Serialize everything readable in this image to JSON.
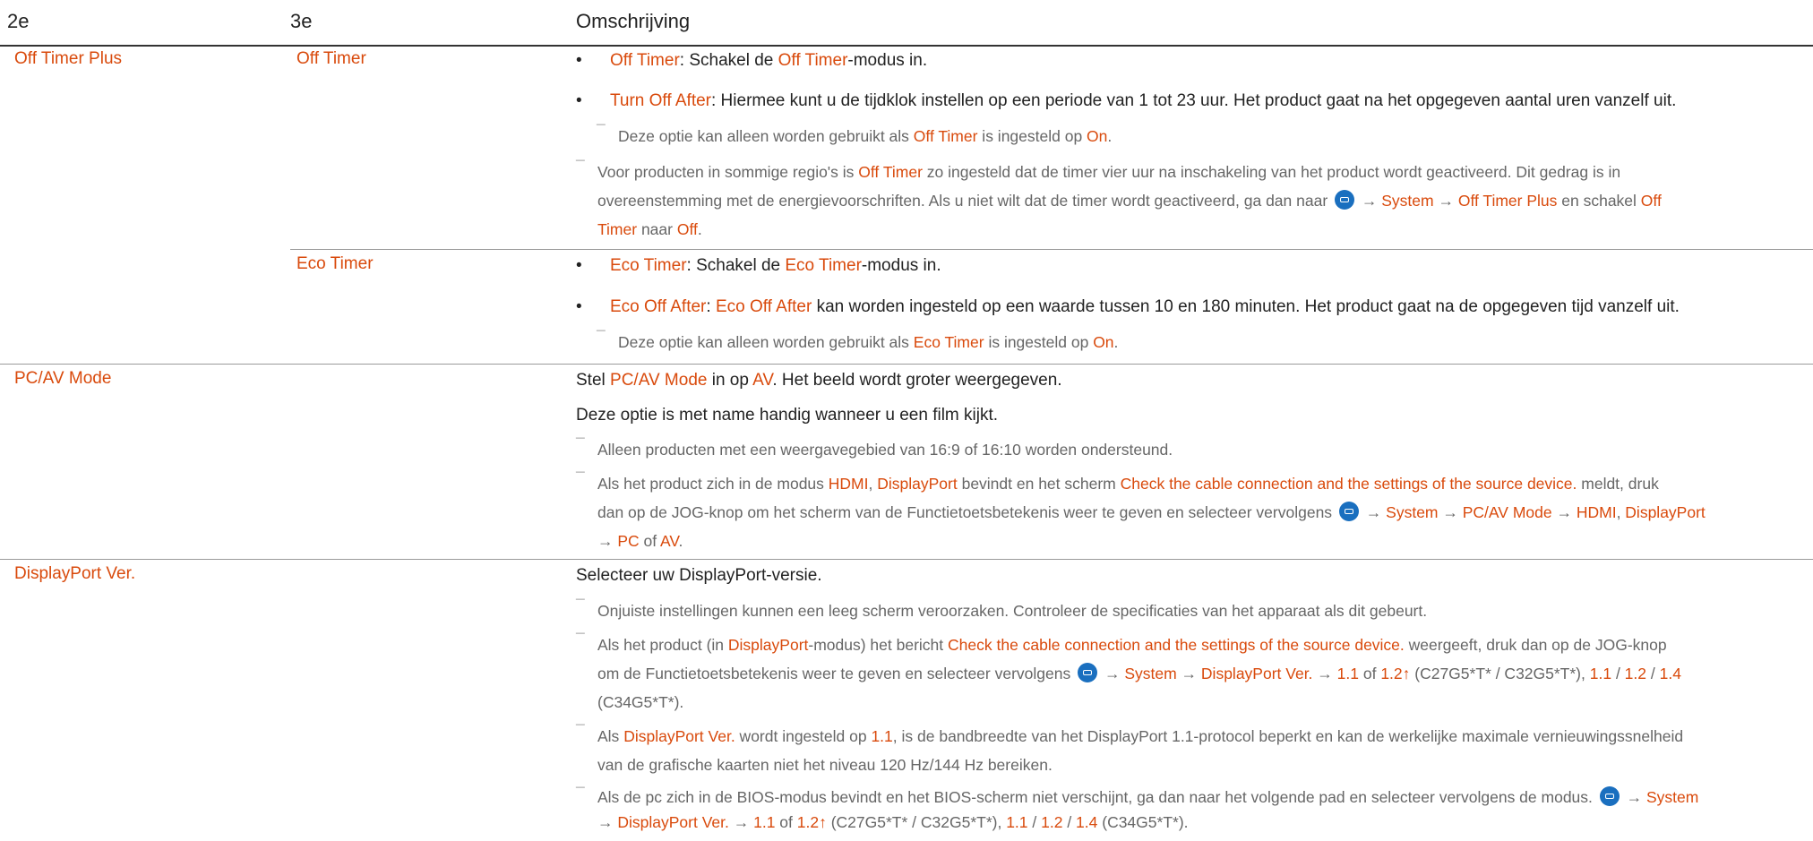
{
  "header": {
    "col1": "2e",
    "col2": "3e",
    "col3": "Omschrijving"
  },
  "sections": {
    "off_timer_plus": {
      "label": "Off Timer Plus",
      "off_timer": {
        "label": "Off Timer",
        "b1": {
          "t1": "Off Timer",
          "t2": ": Schakel de ",
          "t3": "Off Timer",
          "t4": "-modus in."
        },
        "b2": {
          "t1": "Turn Off After",
          "t2": ": Hiermee kunt u de tijdklok instellen op een periode van 1 tot 23 uur. Het product gaat na het opgegeven aantal uren vanzelf uit."
        },
        "n1": {
          "t1": "Deze optie kan alleen worden gebruikt als ",
          "t2": "Off Timer",
          "t3": " is ingesteld op ",
          "t4": "On",
          "t5": "."
        },
        "n2": {
          "t1": "Voor producten in sommige regio's is ",
          "t2": "Off Timer",
          "t3": " zo ingesteld dat de timer vier uur na inschakeling van het product wordt geactiveerd. Dit gedrag is in",
          "t4": "overeenstemming met de energievoorschriften. Als u niet wilt dat de timer wordt geactiveerd, ga dan naar ",
          "t5": " → ",
          "t6": "System",
          "t7": " → ",
          "t8": "Off Timer Plus",
          "t9": " en schakel ",
          "t10": "Off",
          "t11": "Timer",
          "t12": " naar ",
          "t13": "Off",
          "t14": "."
        }
      },
      "eco_timer": {
        "label": "Eco Timer",
        "b1": {
          "t1": "Eco Timer",
          "t2": ": Schakel de ",
          "t3": "Eco Timer",
          "t4": "-modus in."
        },
        "b2": {
          "t1": "Eco Off After",
          "t2": ": ",
          "t3": "Eco Off After",
          "t4": " kan worden ingesteld op een waarde tussen 10 en 180 minuten. Het product gaat na de opgegeven tijd vanzelf uit."
        },
        "n1": {
          "t1": "Deze optie kan alleen worden gebruikt als ",
          "t2": "Eco Timer",
          "t3": " is ingesteld op ",
          "t4": "On",
          "t5": "."
        }
      }
    },
    "pcav": {
      "label": "PC/AV Mode",
      "p1": {
        "t1": "Stel ",
        "t2": "PC/AV Mode",
        "t3": " in op ",
        "t4": "AV",
        "t5": ". Het beeld wordt groter weergegeven."
      },
      "p2": "Deze optie is met name handig wanneer u een film kijkt.",
      "n1": "Alleen producten met een weergavegebied van 16:9 of 16:10 worden ondersteund.",
      "n2": {
        "t1": "Als het product zich in de modus ",
        "t2": "HDMI",
        "t3": ", ",
        "t4": "DisplayPort",
        "t5": " bevindt en het scherm ",
        "t6": "Check the cable connection and the settings of the source device.",
        "t7": " meldt, druk",
        "t8": "dan op de JOG-knop om het scherm van de Functietoetsbetekenis weer te geven en selecteer vervolgens ",
        "t9": " → ",
        "t10": "System",
        "t11": " → ",
        "t12": "PC/AV Mode",
        "t13": " → ",
        "t14": "HDMI",
        "t15": ", ",
        "t16": "DisplayPort",
        "t17": "→ ",
        "t18": "PC",
        "t19": " of ",
        "t20": "AV",
        "t21": "."
      }
    },
    "dp": {
      "label": "DisplayPort Ver.",
      "p1": "Selecteer uw DisplayPort-versie.",
      "n1": "Onjuiste instellingen kunnen een leeg scherm veroorzaken. Controleer de specificaties van het apparaat als dit gebeurt.",
      "n2": {
        "t1": "Als het product (in ",
        "t2": "DisplayPort",
        "t3": "-modus) het bericht ",
        "t4": "Check the cable connection and the settings of the source device.",
        "t5": " weergeeft, druk dan op de JOG-knop",
        "t6": "om de Functietoetsbetekenis weer te geven en selecteer vervolgens ",
        "t7": " → ",
        "t8": "System",
        "t9": " → ",
        "t10": "DisplayPort Ver.",
        "t11": " → ",
        "t12": "1.1",
        "t13": " of ",
        "t14": "1.2↑",
        "t15": " (C27G5*T* / C32G5*T*), ",
        "t16": "1.1",
        "t17": " / ",
        "t18": "1.2",
        "t19": " / ",
        "t20": "1.4",
        "t21": "(C34G5*T*)."
      },
      "n3": {
        "t1": "Als ",
        "t2": "DisplayPort Ver.",
        "t3": " wordt ingesteld op ",
        "t4": "1.1",
        "t5": ", is de bandbreedte van het DisplayPort 1.1-protocol beperkt en kan de werkelijke maximale vernieuwingssnelheid",
        "t6": "van de grafische kaarten niet het niveau 120 Hz/144 Hz bereiken."
      },
      "n4": {
        "t1": "Als de pc zich in de BIOS-modus bevindt en het BIOS-scherm niet verschijnt, ga dan naar het volgende pad en selecteer vervolgens de modus. ",
        "t2": " → ",
        "t3": "System",
        "t4": "→ ",
        "t5": "DisplayPort Ver.",
        "t6": " → ",
        "t7": "1.1",
        "t8": " of ",
        "t9": "1.2↑",
        "t10": " (C27G5*T* / C32G5*T*), ",
        "t11": "1.1",
        "t12": " / ",
        "t13": "1.2",
        "t14": " / ",
        "t15": "1.4",
        "t16": " (C34G5*T*)."
      }
    }
  },
  "colors": {
    "accent": "#d94a0c",
    "text": "#222222",
    "note": "#666666",
    "menu_icon": "#1a6fbf"
  },
  "icons": {
    "menu": "menu-icon",
    "dash": "note-dash-icon"
  }
}
